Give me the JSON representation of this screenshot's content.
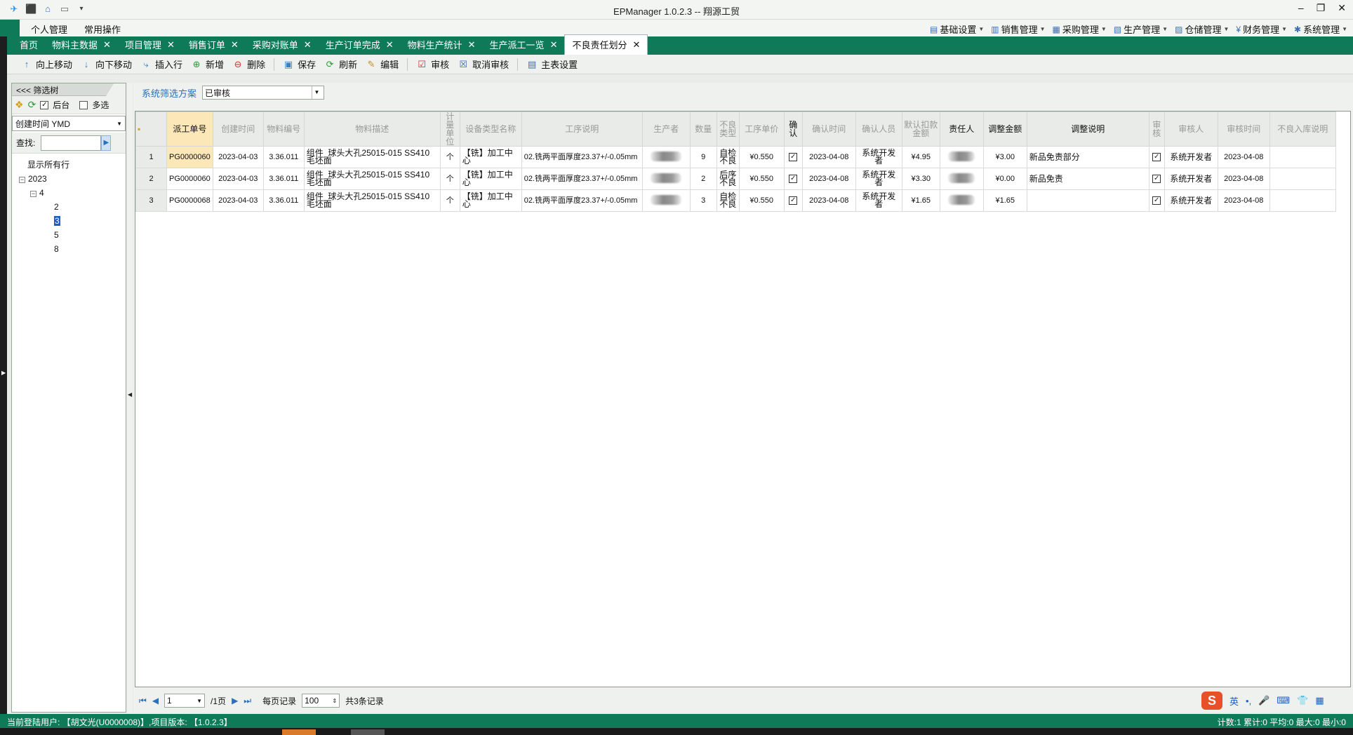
{
  "window": {
    "title": "EPManager 1.0.2.3 -- 翔源工贸",
    "controls": [
      "–",
      "❐",
      "✕"
    ]
  },
  "quick_access": [
    "✈",
    "⬛",
    "⌂",
    "▭",
    "▾"
  ],
  "menu": {
    "left": [
      "个人管理",
      "常用操作"
    ],
    "right": [
      "基础设置",
      "销售管理",
      "采购管理",
      "生产管理",
      "仓储管理",
      "财务管理",
      "系统管理"
    ]
  },
  "tabs": [
    {
      "label": "首页"
    },
    {
      "label": "物料主数据"
    },
    {
      "label": "项目管理"
    },
    {
      "label": "销售订单"
    },
    {
      "label": "采购对账单"
    },
    {
      "label": "生产订单完成"
    },
    {
      "label": "物料生产统计"
    },
    {
      "label": "生产派工一览"
    },
    {
      "label": "不良责任划分",
      "active": true
    }
  ],
  "toolbar": {
    "up": "向上移动",
    "down": "向下移动",
    "insert": "插入行",
    "add": "新增",
    "delete": "删除",
    "save": "保存",
    "refresh": "刷新",
    "edit": "编辑",
    "audit": "审核",
    "unaudit": "取消审核",
    "main_settings": "主表设置"
  },
  "left_panel": {
    "header": "<<< 筛选树",
    "backend_label": "后台",
    "multi_label": "多选",
    "group_by": "创建时间 YMD",
    "find_label": "查找:",
    "tree": {
      "show_all": "显示所有行",
      "year": "2023",
      "month": "4",
      "days": [
        "2",
        "3",
        "5",
        "8"
      ],
      "selected_day": "3"
    }
  },
  "filter": {
    "label": "系统筛选方案",
    "value": "已审核"
  },
  "grid": {
    "columns": [
      "派工单号",
      "创建时间",
      "物料编号",
      "物料描述",
      "计量单位",
      "设备类型名称",
      "工序说明",
      "生产者",
      "数量",
      "不良类型",
      "工序单价",
      "确认",
      "确认时间",
      "确认人员",
      "默认扣款金额",
      "责任人",
      "调整金额",
      "调整说明",
      "审核",
      "审核人",
      "审核时间",
      "不良入库说明"
    ],
    "rows": [
      {
        "no": "1",
        "dispatch": "PG0000060",
        "created": "2023-04-03",
        "material": "3.36.011",
        "desc": "组件_球头大孔25015-015 SS410毛坯面",
        "unit": "个",
        "device": "【铣】加工中心",
        "process": "02.铣两平面厚度23.37+/-0.05mm",
        "qty": "9",
        "defect": "自检不良",
        "price": "¥0.550",
        "confirm_time": "2023-04-08",
        "confirmer": "系统开发者",
        "deduct": "¥4.95",
        "adjust": "¥3.00",
        "adjust_note": "新品免责部分",
        "auditor": "系统开发者",
        "audit_time": "2023-04-08",
        "note": ""
      },
      {
        "no": "2",
        "dispatch": "PG0000060",
        "created": "2023-04-03",
        "material": "3.36.011",
        "desc": "组件_球头大孔25015-015 SS410毛坯面",
        "unit": "个",
        "device": "【铣】加工中心",
        "process": "02.铣两平面厚度23.37+/-0.05mm",
        "qty": "2",
        "defect": "后序不良",
        "price": "¥0.550",
        "confirm_time": "2023-04-08",
        "confirmer": "系统开发者",
        "deduct": "¥3.30",
        "adjust": "¥0.00",
        "adjust_note": "新品免责",
        "auditor": "系统开发者",
        "audit_time": "2023-04-08",
        "note": ""
      },
      {
        "no": "3",
        "dispatch": "PG0000068",
        "created": "2023-04-03",
        "material": "3.36.011",
        "desc": "组件_球头大孔25015-015 SS410毛坯面",
        "unit": "个",
        "device": "【铣】加工中心",
        "process": "02.铣两平面厚度23.37+/-0.05mm",
        "qty": "3",
        "defect": "自检不良",
        "price": "¥0.550",
        "confirm_time": "2023-04-08",
        "confirmer": "系统开发者",
        "deduct": "¥1.65",
        "adjust": "¥1.65",
        "adjust_note": "",
        "auditor": "系统开发者",
        "audit_time": "2023-04-08",
        "note": ""
      }
    ]
  },
  "pager": {
    "page": "1",
    "total_pages": "/1页",
    "per_page_label": "每页记录",
    "per_page": "100",
    "total": "共3条记录"
  },
  "status": {
    "left": "当前登陆用户: 【胡文光(U0000008)】,项目版本: 【1.0.2.3】",
    "right": "计数:1 累计:0 平均:0 最大:0 最小:0"
  },
  "ime": [
    "S",
    "英",
    "•,",
    "🎤",
    "⌨",
    "👕",
    "▦"
  ]
}
